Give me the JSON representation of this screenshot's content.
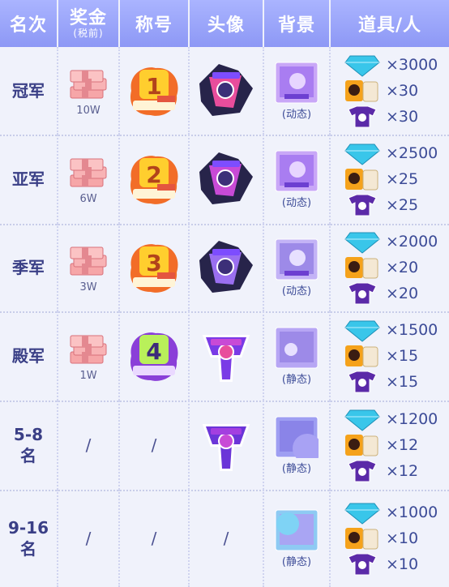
{
  "headers": {
    "rank": "名次",
    "bonus": "奖金",
    "bonus_sub": "(税前)",
    "title": "称号",
    "avatar": "头像",
    "background": "背景",
    "items": "道具/人"
  },
  "rows": [
    {
      "rank": "冠军",
      "bonus": "10W",
      "title_badge": "1",
      "bg_caption": "(动态)",
      "avatar": true,
      "q": [
        "×3000",
        "×30",
        "×30"
      ]
    },
    {
      "rank": "亚军",
      "bonus": "6W",
      "title_badge": "2",
      "bg_caption": "(动态)",
      "avatar": true,
      "q": [
        "×2500",
        "×25",
        "×25"
      ]
    },
    {
      "rank": "季军",
      "bonus": "3W",
      "title_badge": "3",
      "bg_caption": "(动态)",
      "avatar": true,
      "q": [
        "×2000",
        "×20",
        "×20"
      ]
    },
    {
      "rank": "殿军",
      "bonus": "1W",
      "title_badge": "4",
      "bg_caption": "(静态)",
      "avatar": true,
      "q": [
        "×1500",
        "×15",
        "×15"
      ]
    },
    {
      "rank_line1": "5-8",
      "rank_line2": "名",
      "bonus_slash": "/",
      "title_slash": "/",
      "bg_caption": "(静态)",
      "avatar": true,
      "q": [
        "×1200",
        "×12",
        "×12"
      ]
    },
    {
      "rank_line1": "9-16",
      "rank_line2": "名",
      "bonus_slash": "/",
      "title_slash": "/",
      "avatar_slash": "/",
      "bg_caption": "(静态)",
      "q": [
        "×1000",
        "×10",
        "×10"
      ]
    }
  ],
  "colors": {
    "header": "#9aa4fa",
    "rank_text": "#3a3f86",
    "row_bg": "#f0f2fb"
  },
  "icons": {
    "money": "cash-stack-icon",
    "diamond": "diamond-icon",
    "card": "player-card-icon",
    "jersey": "jersey-icon"
  }
}
